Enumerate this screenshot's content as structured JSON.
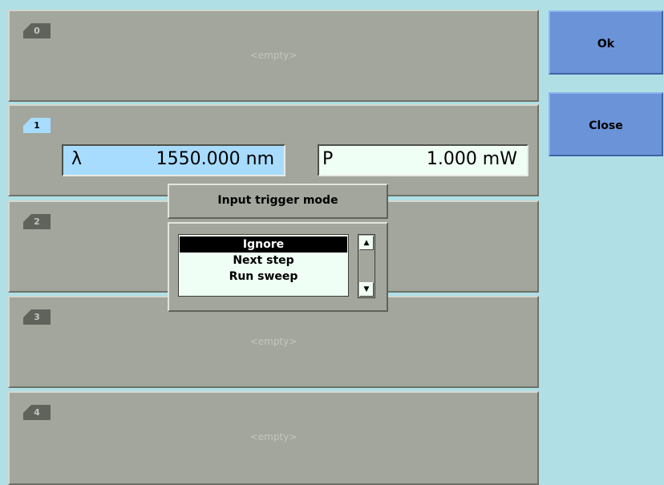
{
  "slots": [
    {
      "number": "0",
      "empty_text": "<empty>"
    },
    {
      "number": "1",
      "wavelength_symbol": "λ",
      "wavelength_value": "1550.000 nm",
      "power_symbol": "P",
      "power_value": "1.000 mW"
    },
    {
      "number": "2"
    },
    {
      "number": "3",
      "empty_text": "<empty>"
    },
    {
      "number": "4",
      "empty_text": "<empty>"
    }
  ],
  "buttons": {
    "ok_label": "Ok",
    "close_label": "Close"
  },
  "popup": {
    "title": "Input trigger mode",
    "options": [
      "Ignore",
      "Next step",
      "Run sweep"
    ],
    "selected": "Ignore"
  },
  "icons": {
    "scroll_up": "up-arrow-icon",
    "scroll_down": "down-arrow-icon"
  },
  "colors": {
    "background": "#b0e0e6",
    "panel": "#a2a69c",
    "button": "#6a93d8",
    "active_tab": "#a8dcff",
    "field_active": "#a8dcff",
    "field": "#f0fff5"
  }
}
